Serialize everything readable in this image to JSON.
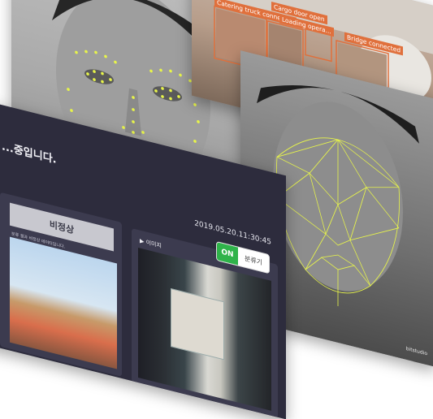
{
  "apron_labels": {
    "catering": "Catering truck connected",
    "cargo": "Cargo door open",
    "loading": "Loading opera...",
    "bridge": "Bridge connected"
  },
  "dashboard": {
    "title": "...중입니다.",
    "timestamp": "2019.05.20.11:30:45",
    "status": "비정상",
    "left_caption": "분류 결과 비정상 데이터입니다.",
    "image_panel_title": "▶ 이미지",
    "toggle_on": "ON",
    "toggle_label": "분류기"
  },
  "watermark": "bitstudio",
  "colors": {
    "dashboard_bg": "#2d2c3d",
    "panel_bg": "#3c3b4f",
    "toggle_on": "#2fb34a",
    "landmark": "#e8f54a",
    "bbox": "#e0703c"
  }
}
